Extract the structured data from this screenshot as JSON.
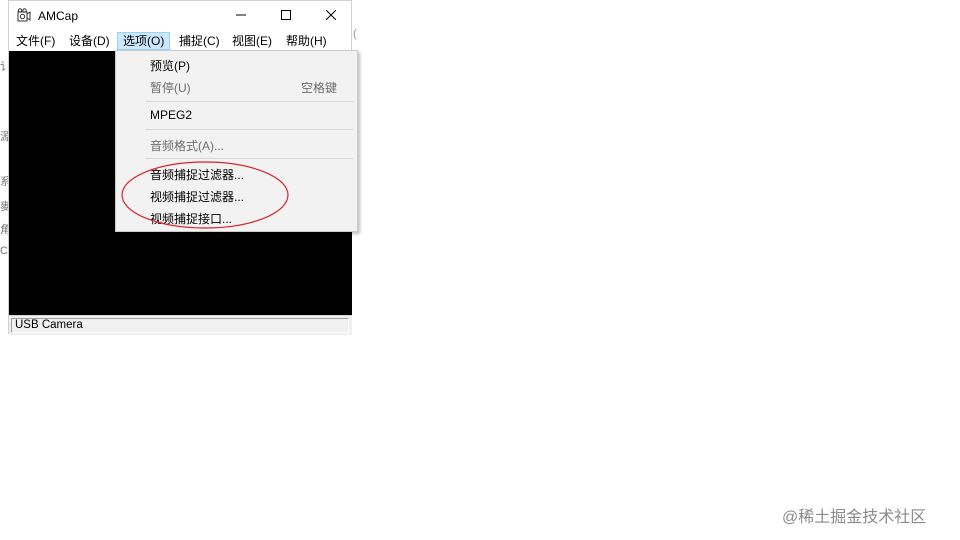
{
  "window": {
    "title": "AMCap",
    "controls": {
      "minimize": "—",
      "maximize": "☐",
      "close": "✕"
    }
  },
  "menubar": {
    "items": [
      {
        "label": "文件(F)"
      },
      {
        "label": "设备(D)"
      },
      {
        "label": "选项(O)",
        "active": true
      },
      {
        "label": "捕捉(C)"
      },
      {
        "label": "视图(E)"
      },
      {
        "label": "帮助(H)"
      }
    ]
  },
  "options_menu": {
    "items": [
      {
        "label": "预览(P)",
        "enabled": true
      },
      {
        "label": "暂停(U)",
        "enabled": false,
        "shortcut": "空格键"
      },
      {
        "label": "MPEG2",
        "enabled": true
      },
      {
        "label": "音频格式(A)...",
        "enabled": false
      },
      {
        "label": "音频捕捉过滤器...",
        "enabled": true
      },
      {
        "label": "视频捕捉过滤器...",
        "enabled": true
      },
      {
        "label": "视频捕捉接口...",
        "enabled": true
      }
    ]
  },
  "statusbar": {
    "text": "USB Camera"
  },
  "background_fragments": [
    "讠",
    "源",
    "系",
    "麥",
    "角",
    "C",
    "("
  ],
  "watermark": "@稀土掘金技术社区",
  "colors": {
    "menu_highlight": "#cce8ff",
    "video_bg": "#000000",
    "annotation": "#d9232d"
  }
}
